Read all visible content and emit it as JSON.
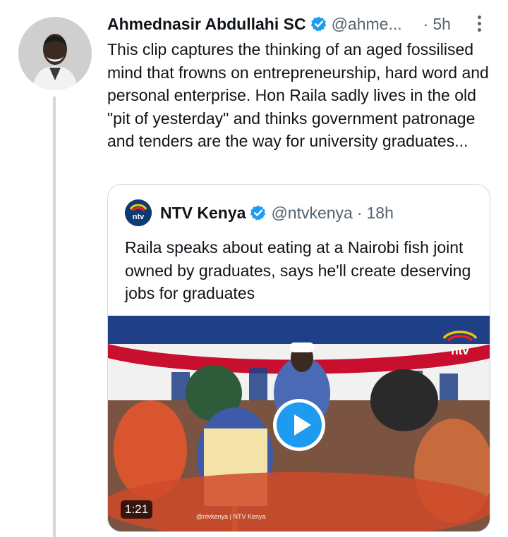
{
  "tweet": {
    "author_name": "Ahmednasir Abdullahi SC",
    "handle": "@ahme...",
    "separator": "·",
    "time": "5h",
    "text": "This clip captures the thinking of an aged fossilised mind that frowns on entrepreneurship, hard word and personal enterprise. Hon Raila sadly lives in the old \"pit of yesterday\" and thinks government patronage and tenders are the way for university graduates...",
    "avatar_icon": "person-avatar",
    "more_icon": "more-vertical-icon"
  },
  "quoted_tweet": {
    "author_name": "NTV Kenya",
    "handle": "@ntvkenya",
    "separator": "·",
    "time": "18h",
    "text": "Raila speaks about eating at a Nairobi fish joint owned by graduates, says he'll create deserving jobs for graduates",
    "avatar_text": "ntv",
    "video": {
      "duration": "1:21",
      "watermark": "ntv",
      "footer_text": "@ntvkenya | NTV Kenya",
      "play_icon": "play-icon"
    }
  },
  "colors": {
    "accent": "#1d9bf0",
    "text": "#0f1419",
    "muted": "#536471",
    "border": "#cfd9de"
  }
}
